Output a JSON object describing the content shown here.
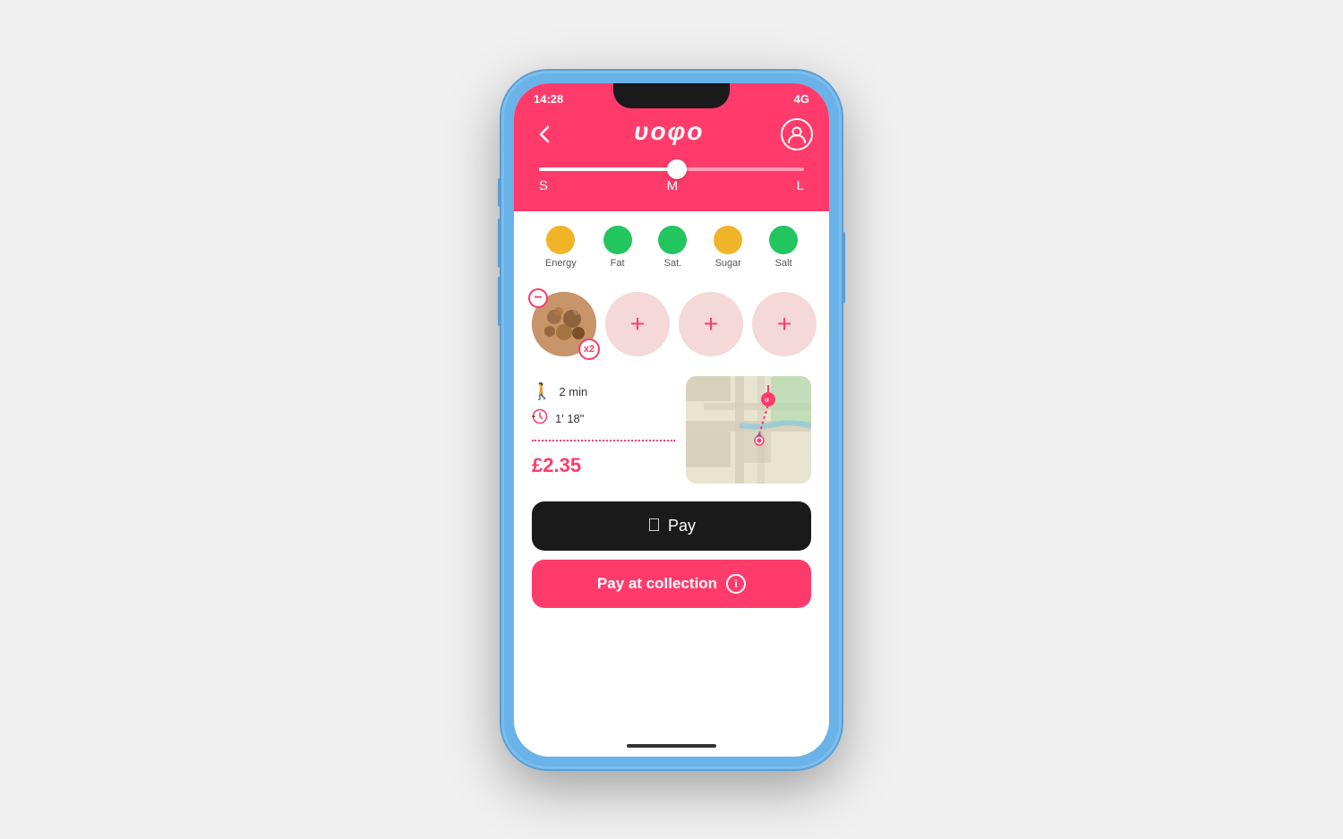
{
  "phone": {
    "status_bar": {
      "time": "14:28",
      "signal": "4G"
    },
    "header": {
      "back_label": "‹",
      "logo": "υοφο",
      "profile_icon": "person-icon"
    },
    "slider": {
      "labels": [
        "S",
        "M",
        "L"
      ],
      "current": "M",
      "position_percent": 52
    },
    "nutrition": {
      "items": [
        {
          "label": "Energy",
          "color": "yellow"
        },
        {
          "label": "Fat",
          "color": "green"
        },
        {
          "label": "Sat.",
          "color": "green"
        },
        {
          "label": "Sugar",
          "color": "yellow"
        },
        {
          "label": "Salt",
          "color": "green"
        }
      ]
    },
    "food_items": [
      {
        "type": "filled",
        "badge": "x2",
        "has_minus": true
      },
      {
        "type": "empty_plus"
      },
      {
        "type": "empty_plus"
      },
      {
        "type": "empty_plus"
      }
    ],
    "location": {
      "walk_time": "2 min",
      "prep_time": "1' 18\"",
      "price": "£2.35"
    },
    "buttons": {
      "apple_pay": "Pay",
      "apple_pay_prefix": "",
      "pay_collection": "Pay at collection"
    }
  }
}
